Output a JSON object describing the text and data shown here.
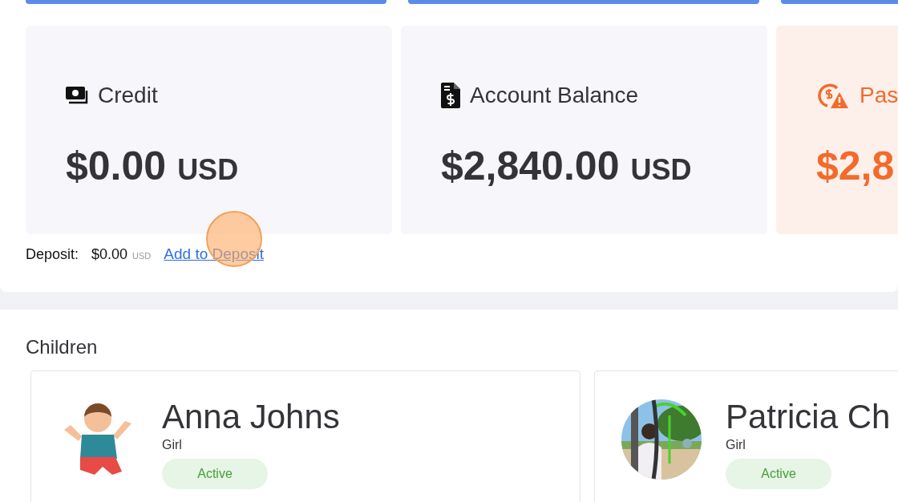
{
  "top_buttons": [
    {
      "kind": "bar"
    },
    {
      "kind": "bar"
    },
    {
      "kind": "bar"
    }
  ],
  "stats": [
    {
      "kind": "credit",
      "title": "Credit",
      "amount": "$0.00",
      "currency": "USD"
    },
    {
      "kind": "balance",
      "title": "Account Balance",
      "amount": "$2,840.00",
      "currency": "USD"
    },
    {
      "kind": "past_due",
      "title": "Pas",
      "amount": "$2,8"
    }
  ],
  "deposit": {
    "label": "Deposit:",
    "amount": "$0.00",
    "currency": "USD",
    "link": "Add to Deposit"
  },
  "click_marker": {
    "kind": "circle"
  },
  "children": {
    "title": "Children",
    "items": [
      {
        "name": "Anna Johns",
        "gender": "Girl",
        "status": "Active"
      },
      {
        "name": "Patricia Ch",
        "gender": "Girl",
        "status": "Active"
      }
    ]
  }
}
